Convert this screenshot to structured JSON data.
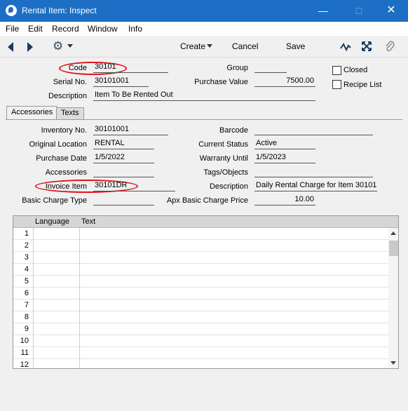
{
  "window": {
    "title": "Rental Item: Inspect",
    "min_icon": "minimize-icon",
    "max_icon": "maximize-icon",
    "close_icon": "close-icon"
  },
  "menu": {
    "file": "File",
    "edit": "Edit",
    "record": "Record",
    "window": "Window",
    "info": "Info"
  },
  "toolbar": {
    "create": "Create",
    "cancel": "Cancel",
    "save": "Save"
  },
  "header": {
    "code_label": "Code",
    "code": "30101",
    "group_label": "Group",
    "group": "",
    "closed_label": "Closed",
    "serial_label": "Serial No.",
    "serial": "30101001",
    "purchase_value_label": "Purchase Value",
    "purchase_value": "7500.00",
    "recipe_list_label": "Recipe List",
    "description_label": "Description",
    "description": "Item To Be Rented Out"
  },
  "tabs": {
    "accessories": "Accessories",
    "texts": "Texts"
  },
  "accessories": {
    "inventory_no_label": "Inventory No.",
    "inventory_no": "30101001",
    "barcode_label": "Barcode",
    "barcode": "",
    "original_location_label": "Original Location",
    "original_location": "RENTAL",
    "current_status_label": "Current Status",
    "current_status": "Active",
    "purchase_date_label": "Purchase Date",
    "purchase_date": "1/5/2022",
    "warranty_until_label": "Warranty Until",
    "warranty_until": "1/5/2023",
    "accessories_label": "Accessories",
    "accessories": "",
    "tags_label": "Tags/Objects",
    "tags": "",
    "invoice_item_label": "Invoice Item",
    "invoice_item": "30101DR",
    "description_label": "Description",
    "description": "Daily Rental Charge for Item 30101",
    "basic_charge_type_label": "Basic Charge Type",
    "basic_charge_type": "",
    "apx_basic_charge_price_label": "Apx Basic Charge Price",
    "apx_basic_charge_price": "10.00"
  },
  "grid": {
    "col_language": "Language",
    "col_text": "Text",
    "rows": [
      "1",
      "2",
      "3",
      "4",
      "5",
      "6",
      "7",
      "8",
      "9",
      "10",
      "11",
      "12"
    ]
  },
  "colors": {
    "titlebar": "#1c6fc4",
    "highlight_oval": "#e0141e"
  }
}
